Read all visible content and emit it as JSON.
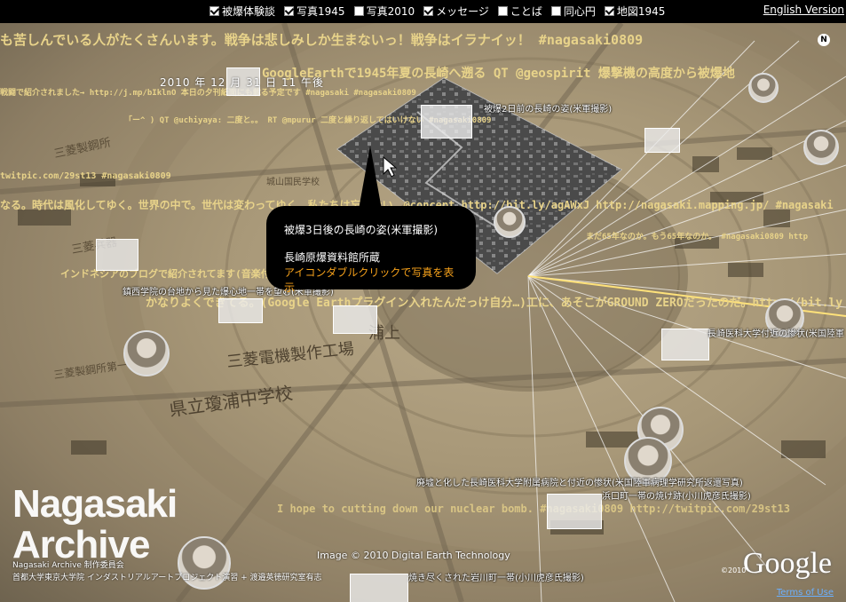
{
  "topbar": {
    "layers": [
      {
        "label": "被爆体験談",
        "checked": true
      },
      {
        "label": "写真1945",
        "checked": true
      },
      {
        "label": "写真2010",
        "checked": false
      },
      {
        "label": "メッセージ",
        "checked": true
      },
      {
        "label": "ことば",
        "checked": false
      },
      {
        "label": "同心円",
        "checked": false
      },
      {
        "label": "地図1945",
        "checked": true
      }
    ],
    "english_link": "English Version"
  },
  "date_readout": "2010 年 12 月 31 日 11 午後",
  "tickers": [
    "も苦しんでいる人がたくさんいます。戦争は悲しみしか生まないっ！戦争はイラナイッ！ #nagasaki0809",
    "GoogleEarthで1945年夏の長崎へ遡る QT @geospirit 爆撃機の高度から被爆地",
    "戦闘で紹介されました→ http://j.mp/bIklnO 本日の夕刊紙面にも載る予定です #nagasaki #nagasaki0809",
    "「ー^ ) QT @uchiyaya: 二度と。。 RT @mpurur 二度と繰り返してはいけない #nagasaki0809",
    "twitpic.com/29st13 #nagasaki0809",
    "なる。時代は風化してゆく。世界の中で。世代は変わってゆく。私たちは忘れない。@concept http://bit.ly/agAWxJ http://nagasaki.mapping.jp/ #nagasaki",
    "まだ65年なのか。もう65年なのか。 #nagasaki0809 http",
    "インドネシアのブログで紹介されてます(音楽付き)",
    "かなりよくできてる。(Google Earthプラグイン入れたんだっけ自分…)工に、あそこがGROUND ZEROだったのだ。http://bit.ly",
    "I hope to cutting down our nuclear bomb. #nagasaki0809 http://twitpic.com/29st13"
  ],
  "photo_labels": [
    "被爆2日前の長崎の姿(米軍撮影)",
    "鎮西学院の台地から見た爆心地一帯を望む(米軍撮影)",
    "長崎医科大学付近の惨状(米国陸軍",
    "廃墟と化した長崎医科大学附属病院と付近の惨状(米国陸軍病理学研究所返還写真)",
    "浜口町一帯の焼け跡(小川虎彦氏撮影)",
    "焼き尽くされた岩川町一帯(小川虎彦氏撮影)"
  ],
  "popup": {
    "title": "被爆3日後の長崎の姿(米軍撮影)",
    "source": "長崎原爆資料館所蔵",
    "hint": "アイコンダブルクリックで写真を表示"
  },
  "logo": {
    "line1": "Nagasaki",
    "line2": "Archive"
  },
  "credits": {
    "line1": "Nagasaki Archive 制作委員会",
    "line2": "首都大学東京大学院 インダストリアルアートプロジェクト演習 + 渡邉英徳研究室有志"
  },
  "imagery_copyright": "Image © 2010 Digital Earth Technology",
  "google_logo": "Google",
  "google_year": "©2010",
  "terms_link": "Terms of Use",
  "compass_letter": "N",
  "map_labels": [
    "三菱製鋼所",
    "三菱兵器",
    "県立瓊浦中学校",
    "三菱電機製作工場",
    "浦上",
    "城山国民学校",
    "三菱製鋼所第一工場",
    "長崎"
  ],
  "colors": {
    "ticker": "#e8d38a",
    "hint": "#f7a21b",
    "sepia": "#a89878"
  }
}
